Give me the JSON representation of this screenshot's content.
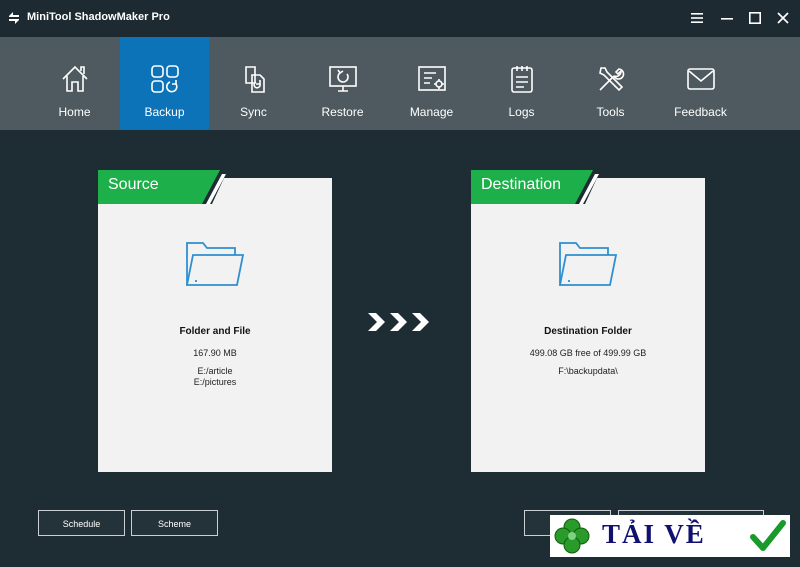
{
  "window": {
    "title": "MiniTool ShadowMaker Pro",
    "controls": [
      "menu-icon",
      "minimize-icon",
      "maximize-icon",
      "close-icon"
    ]
  },
  "nav": {
    "items": [
      {
        "label": "Home",
        "icon": "home-icon",
        "active": false
      },
      {
        "label": "Backup",
        "icon": "backup-icon",
        "active": true
      },
      {
        "label": "Sync",
        "icon": "sync-icon",
        "active": false
      },
      {
        "label": "Restore",
        "icon": "restore-icon",
        "active": false
      },
      {
        "label": "Manage",
        "icon": "manage-icon",
        "active": false
      },
      {
        "label": "Logs",
        "icon": "logs-icon",
        "active": false
      },
      {
        "label": "Tools",
        "icon": "tools-icon",
        "active": false
      },
      {
        "label": "Feedback",
        "icon": "feedback-icon",
        "active": false
      }
    ],
    "active_color": "#0c73b8"
  },
  "source": {
    "header": "Source",
    "name": "Folder and File",
    "size": "167.90 MB",
    "paths": [
      "E:/article",
      "E:/pictures"
    ]
  },
  "destination": {
    "header": "Destination",
    "name": "Destination Folder",
    "free": "499.08 GB free of 499.99 GB",
    "path": "F:\\backupdata\\"
  },
  "buttons": {
    "schedule": "Schedule",
    "scheme": "Scheme"
  },
  "watermark": {
    "text": "TẢI VỀ"
  },
  "colors": {
    "accent_green": "#1db04a",
    "folder_blue": "#2e8fd0",
    "background": "#1e2c33"
  }
}
